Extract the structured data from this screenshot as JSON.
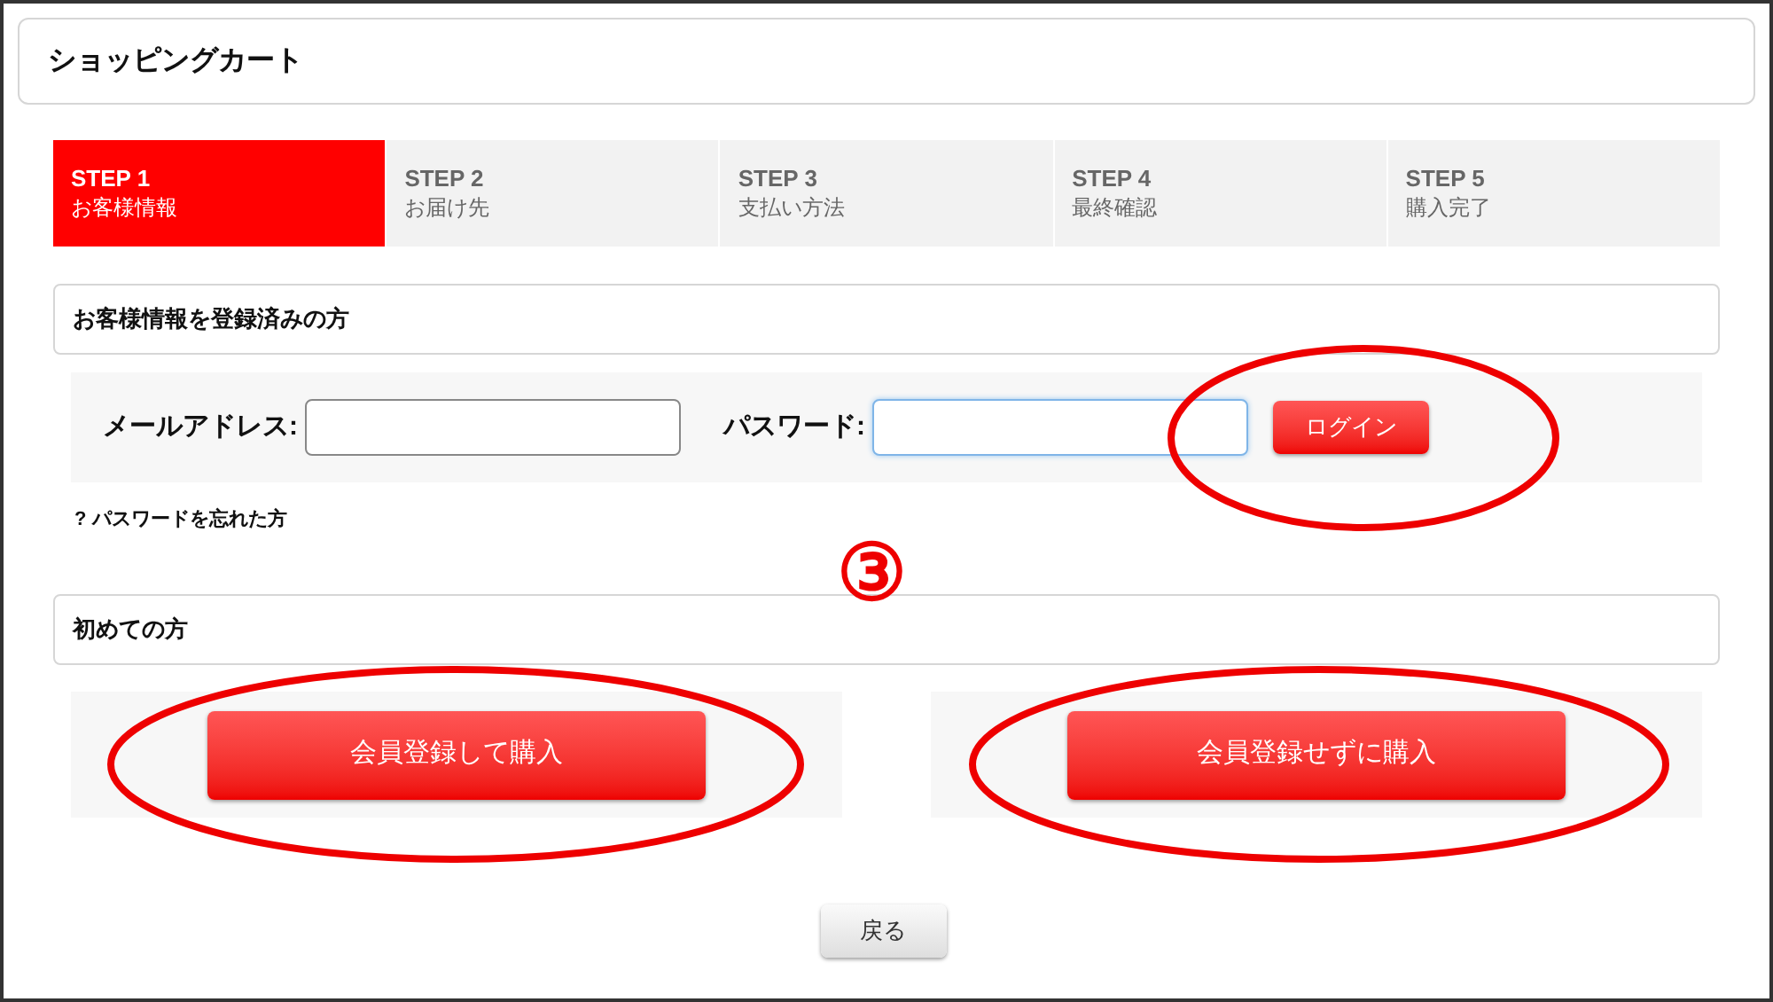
{
  "title": "ショッピングカート",
  "steps": [
    {
      "label": "STEP 1",
      "name": "お客様情報",
      "selected": true
    },
    {
      "label": "STEP 2",
      "name": "お届け先",
      "selected": false
    },
    {
      "label": "STEP 3",
      "name": "支払い方法",
      "selected": false
    },
    {
      "label": "STEP 4",
      "name": "最終確認",
      "selected": false
    },
    {
      "label": "STEP 5",
      "name": "購入完了",
      "selected": false
    }
  ],
  "registered": {
    "heading": "お客様情報を登録済みの方",
    "fields": [
      {
        "label": "メールアドレス:",
        "focused": false
      },
      {
        "label": "パスワード:",
        "focused": true
      }
    ],
    "login_button": "ログイン",
    "forgot_link": "? パスワードを忘れた方"
  },
  "annotation_marker": "③",
  "new_customer": {
    "heading": "初めての方",
    "buttons": [
      "会員登録して購入",
      "会員登録せずに購入"
    ]
  },
  "back_button": "戻る"
}
